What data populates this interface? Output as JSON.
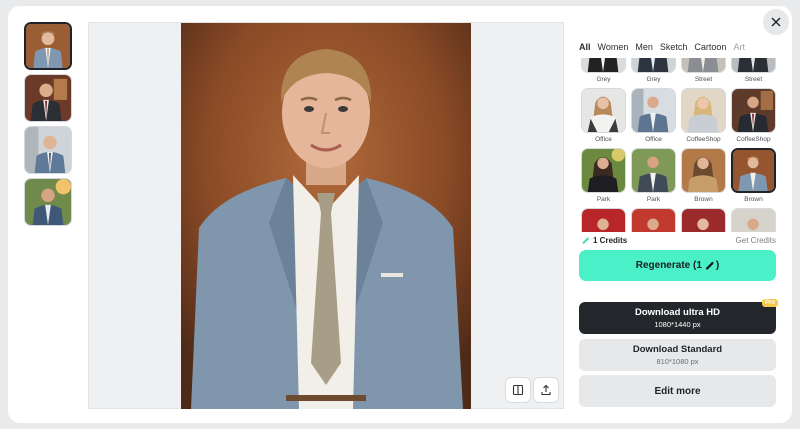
{
  "tabs": [
    {
      "label": "All",
      "active": true
    },
    {
      "label": "Women"
    },
    {
      "label": "Men"
    },
    {
      "label": "Sketch"
    },
    {
      "label": "Cartoon"
    },
    {
      "label": "Art"
    }
  ],
  "styles": [
    {
      "label": "Grey"
    },
    {
      "label": "Grey"
    },
    {
      "label": "Street"
    },
    {
      "label": "Street"
    },
    {
      "label": "Office"
    },
    {
      "label": "Office"
    },
    {
      "label": "CoffeeShop"
    },
    {
      "label": "CoffeeShop"
    },
    {
      "label": "Park"
    },
    {
      "label": "Park"
    },
    {
      "label": "Brown"
    },
    {
      "label": "Brown",
      "selected": true
    },
    {
      "label": ""
    },
    {
      "label": ""
    },
    {
      "label": ""
    },
    {
      "label": ""
    }
  ],
  "credits": {
    "amount": "1 Credits",
    "get_label": "Get Credits"
  },
  "regenerate_label": "Regenerate (1",
  "download_hd": {
    "title": "Download ultra HD",
    "size": "1080*1440 px",
    "badge": "Pro"
  },
  "download_standard": {
    "title": "Download Standard",
    "size": "810*1080 px"
  },
  "edit_label": "Edit more",
  "colors": {
    "accent": "#4af0c8",
    "dark": "#23272b",
    "pro": "#f6c84a"
  }
}
